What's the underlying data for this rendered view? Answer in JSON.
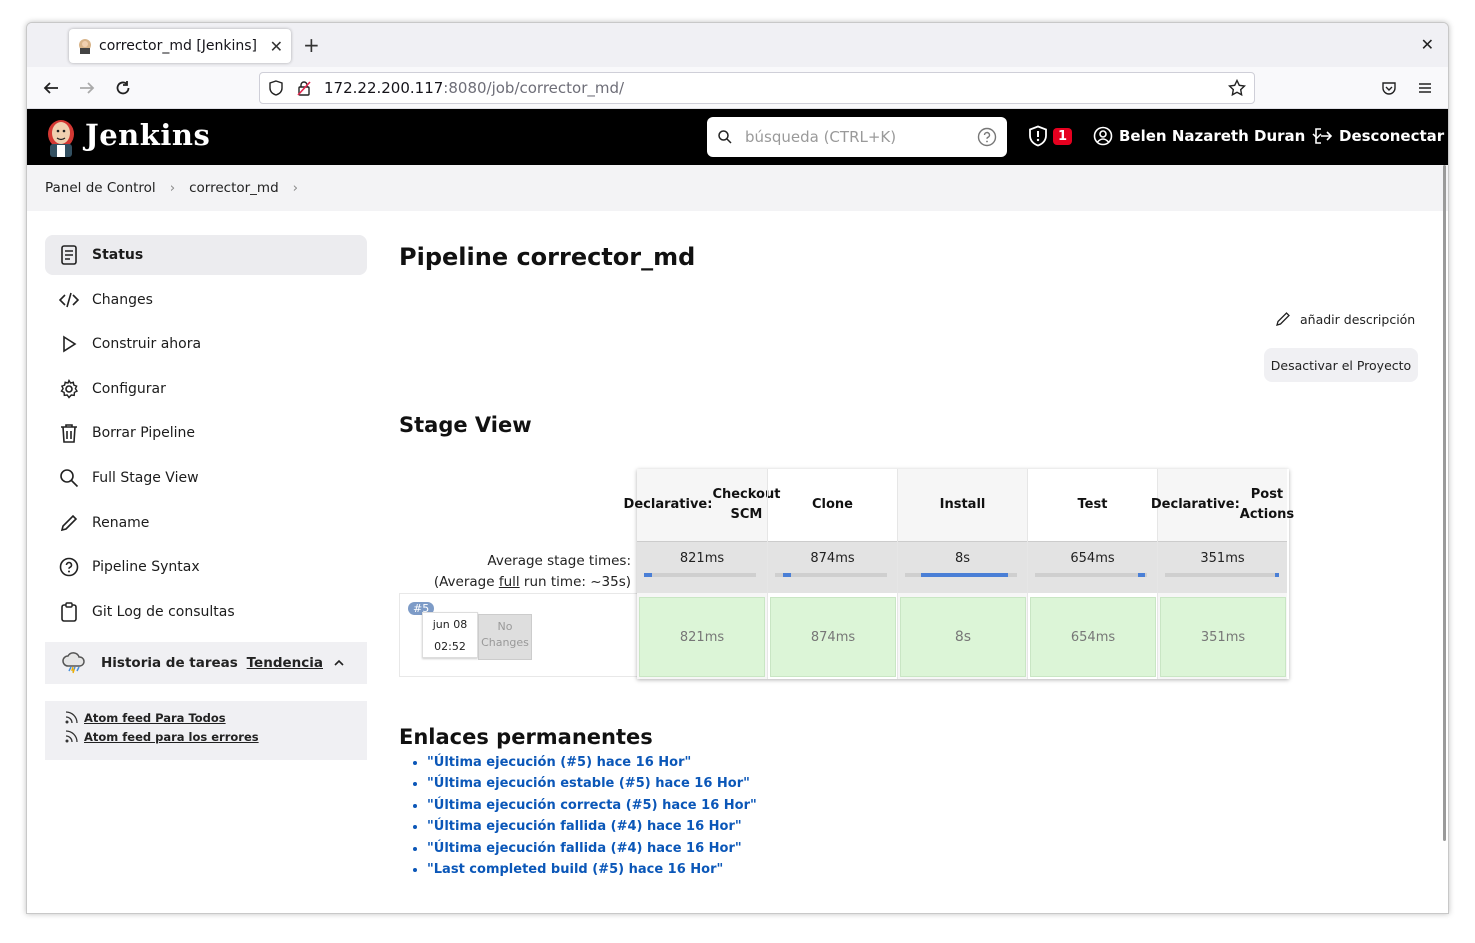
{
  "browser": {
    "tab_title": "corrector_md [Jenkins]",
    "new_tab": "+",
    "close_window": "✕",
    "url_host": "172.22.200.117",
    "url_rest": ":8080/job/corrector_md/"
  },
  "header": {
    "brand": "Jenkins",
    "search_placeholder": "búsqueda (CTRL+K)",
    "security_count": "1",
    "user_name": "Belen Nazareth Duran",
    "logout_label": "Desconectar"
  },
  "breadcrumb": [
    "Panel de Control",
    "corrector_md"
  ],
  "sidebar": {
    "items": [
      {
        "label": "Status",
        "icon": "document-icon"
      },
      {
        "label": "Changes",
        "icon": "code-icon"
      },
      {
        "label": "Construir ahora",
        "icon": "play-icon"
      },
      {
        "label": "Configurar",
        "icon": "gear-icon"
      },
      {
        "label": "Borrar Pipeline",
        "icon": "trash-icon"
      },
      {
        "label": "Full Stage View",
        "icon": "search-icon"
      },
      {
        "label": "Rename",
        "icon": "pencil-icon"
      },
      {
        "label": "Pipeline Syntax",
        "icon": "help-icon"
      },
      {
        "label": "Git Log de consultas",
        "icon": "clipboard-icon"
      }
    ],
    "history_label": "Historia de tareas",
    "trend_label": "Tendencia",
    "feed_all": "Atom feed Para Todos",
    "feed_errors": "Atom feed para los errores"
  },
  "main": {
    "title": "Pipeline corrector_md",
    "add_description": "añadir descripción",
    "disable_button": "Desactivar el Proyecto",
    "stage_view_title": "Stage View",
    "avg_label_1": "Average stage times:",
    "avg_label_2_pre": "(Average ",
    "avg_label_2_link": "full",
    "avg_label_2_post": " run time: ~35s)",
    "run": {
      "tag": "#5",
      "date": "jun 08",
      "time": "02:52",
      "changes_1": "No",
      "changes_2": "Changes"
    },
    "stages": [
      {
        "name_1": "Declarative:",
        "name_2": "Checkout SCM",
        "avg": "821ms",
        "cell": "821ms",
        "bar_start": 0.0,
        "bar_end": 0.07
      },
      {
        "name_1": "Clone",
        "name_2": "",
        "avg": "874ms",
        "cell": "874ms",
        "bar_start": 0.07,
        "bar_end": 0.14
      },
      {
        "name_1": "Install",
        "name_2": "",
        "avg": "8s",
        "cell": "8s",
        "bar_start": 0.14,
        "bar_end": 0.92
      },
      {
        "name_1": "Test",
        "name_2": "",
        "avg": "654ms",
        "cell": "654ms",
        "bar_start": 0.92,
        "bar_end": 0.98
      },
      {
        "name_1": "Declarative:",
        "name_2": "Post Actions",
        "avg": "351ms",
        "cell": "351ms",
        "bar_start": 0.98,
        "bar_end": 1.0
      }
    ],
    "permalinks_title": "Enlaces permanentes",
    "permalinks": [
      "\"Última ejecución (#5) hace 16 Hor\"",
      "\"Última ejecución estable (#5) hace 16 Hor\"",
      "\"Última ejecución correcta (#5) hace 16 Hor\"",
      "\"Última ejecución fallida (#4) hace 16 Hor\"",
      "\"Última ejecución fallida (#4) hace 16 Hor\"",
      "\"Last completed build (#5) hace 16 Hor\""
    ]
  },
  "colors": {
    "header_bg": "#000000",
    "stage_success": "#dcf5d7",
    "link": "#0b57b8",
    "badge": "#e6001f"
  }
}
